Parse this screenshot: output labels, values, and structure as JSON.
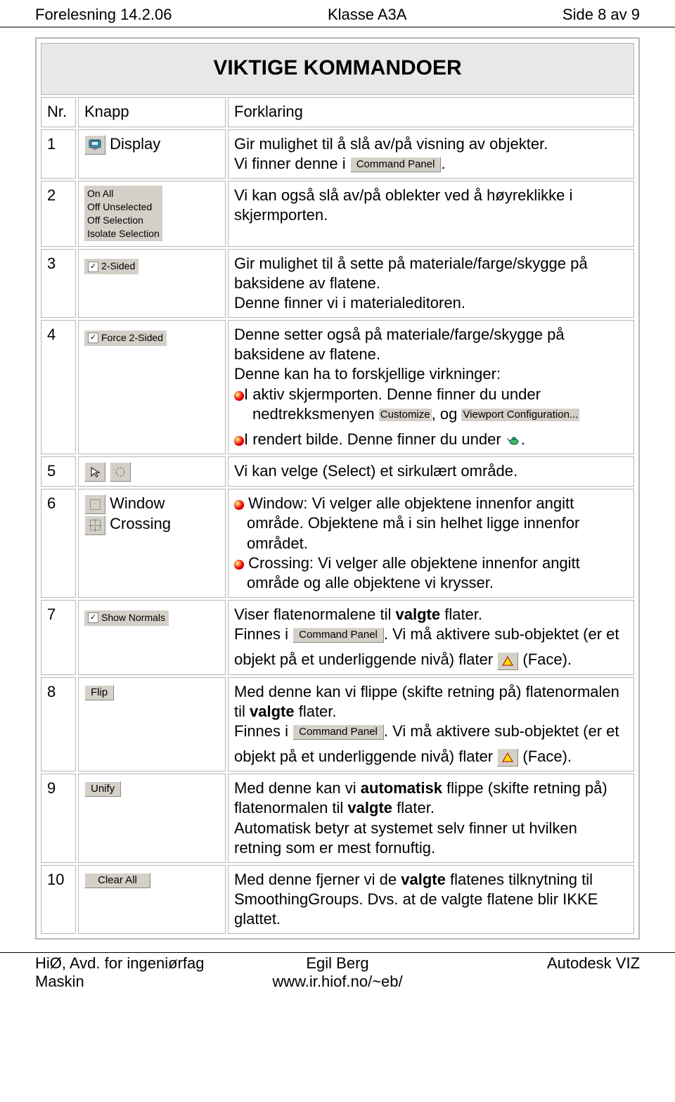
{
  "header": {
    "left": "Forelesning 14.2.06",
    "center": "Klasse A3A",
    "right": "Side 8 av 9"
  },
  "title": "VIKTIGE KOMMANDOER",
  "columns": {
    "nr": "Nr.",
    "knapp": "Knapp",
    "forklaring": "Forklaring"
  },
  "labels": {
    "command_panel": "Command Panel",
    "customize": "Customize",
    "viewport_config": "Viewport Configuration..."
  },
  "rows": {
    "r1": {
      "nr": "1",
      "knapp_text": "Display",
      "text1": "Gir mulighet til å slå av/på visning av objekter.",
      "text2a": "Vi finner denne i ",
      "text2b": "."
    },
    "r2": {
      "nr": "2",
      "menu": [
        "On All",
        "Off Unselected",
        "Off Selection",
        "Isolate Selection"
      ],
      "text": "Vi kan også slå av/på oblekter ved å høyreklikke i skjermporten."
    },
    "r3": {
      "nr": "3",
      "chk": "2-Sided",
      "text": "Gir mulighet til å sette på materiale/farge/skygge på baksidene av flatene.\nDenne finner vi i materialeditoren."
    },
    "r4": {
      "nr": "4",
      "chk": "Force 2-Sided",
      "p1": "Denne setter også på materiale/farge/skygge på baksidene av flatene.",
      "p2": "Denne kan ha to forskjellige virkninger:",
      "p3a": "I aktiv skjermporten. Denne finner du under",
      "p3b": "nedtrekksmenyen ",
      "p3c": ", og  ",
      "p4a": "I rendert bilde. Denne finner du under  ",
      "p4b": "."
    },
    "r5": {
      "nr": "5",
      "text": "Vi kan velge (Select) et sirkulært område."
    },
    "r6": {
      "nr": "6",
      "k1": "Window",
      "k2": "Crossing",
      "l1": "Window: Vi velger alle objektene innenfor angitt område. Objektene må i sin helhet ligge innenfor området.",
      "l2": "Crossing: Vi velger alle objektene innenfor angitt område og alle objektene vi krysser."
    },
    "r7": {
      "nr": "7",
      "chk": "Show Normals",
      "p1a": "Viser flatenormalene til ",
      "p1b": "valgte",
      "p1c": " flater.",
      "p2a": "Finnes i ",
      "p2b": ". Vi må aktivere sub-objektet (er et",
      "p3a": "objekt på et underliggende nivå) flater ",
      "p3b": "(Face)."
    },
    "r8": {
      "nr": "8",
      "btn": "Flip",
      "p1a": "Med denne kan vi flippe (skifte retning på) flatenormalen til ",
      "p1b": "valgte",
      "p1c": " flater.",
      "p2a": "Finnes i ",
      "p2b": ". Vi må aktivere sub-objektet (er et",
      "p3a": "objekt på et underliggende nivå) flater ",
      "p3b": "(Face)."
    },
    "r9": {
      "nr": "9",
      "btn": "Unify",
      "p1a": "Med denne kan vi ",
      "p1b": "automatisk",
      "p1c": " flippe (skifte retning på) flatenormalen til ",
      "p1d": "valgte",
      "p1e": " flater.",
      "p2": "Automatisk betyr at systemet selv finner ut hvilken retning som er mest fornuftig."
    },
    "r10": {
      "nr": "10",
      "btn": "Clear All",
      "p1a": "Med denne fjerner vi de ",
      "p1b": "valgte",
      "p1c": " flatenes tilknytning til SmoothingGroups. Dvs. at de valgte flatene blir IKKE glattet."
    }
  },
  "footer": {
    "left1": "HiØ, Avd. for ingeniørfag",
    "left2": "Maskin",
    "mid1": "Egil Berg",
    "mid2": "www.ir.hiof.no/~eb/",
    "right": "Autodesk VIZ"
  }
}
